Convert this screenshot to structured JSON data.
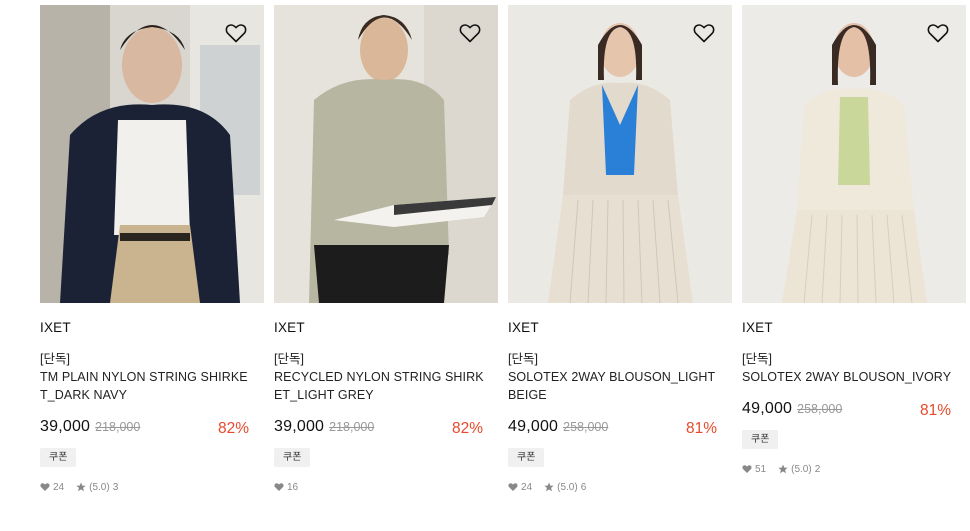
{
  "products": [
    {
      "brand": "IXET",
      "tag": "[단독]",
      "name": "TM PLAIN NYLON STRING SHIRKET_DARK NAVY",
      "price": "39,000",
      "original_price": "218,000",
      "discount": "82%",
      "coupon": "쿠폰",
      "likes": "24",
      "rating": "(5.0)",
      "reviews": "3"
    },
    {
      "brand": "IXET",
      "tag": "[단독]",
      "name": "RECYCLED NYLON STRING SHIRKET_LIGHT GREY",
      "price": "39,000",
      "original_price": "218,000",
      "discount": "82%",
      "coupon": "쿠폰",
      "likes": "16"
    },
    {
      "brand": "IXET",
      "tag": "[단독]",
      "name": "SOLOTEX 2WAY BLOUSON_LIGHT BEIGE",
      "price": "49,000",
      "original_price": "258,000",
      "discount": "81%",
      "coupon": "쿠폰",
      "likes": "24",
      "rating": "(5.0)",
      "reviews": "6"
    },
    {
      "brand": "IXET",
      "tag": "[단독]",
      "name": "SOLOTEX 2WAY BLOUSON_IVORY",
      "price": "49,000",
      "original_price": "258,000",
      "discount": "81%",
      "coupon": "쿠폰",
      "likes": "51",
      "rating": "(5.0)",
      "reviews": "2"
    }
  ],
  "colors": {
    "discount": "#e8492c",
    "strike": "#999999",
    "coupon_bg": "#f0f0f0"
  }
}
